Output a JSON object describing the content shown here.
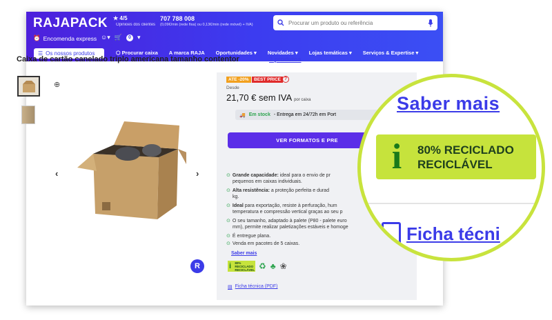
{
  "header": {
    "logo": "RAJAPACK",
    "rating": "4/5",
    "rating_sub": "Opiniões dos clientes",
    "phone": "707 788 008",
    "phone_sub": "(0,09€/min (rede fixa) ou 0,13€/min (rede móvel) + IVA)",
    "search_placeholder": "Procurar um produto ou referência",
    "express": "Encomenda express",
    "cart_count": "0"
  },
  "nav": {
    "products_button": "Os nossos produtos",
    "items": [
      "Procurar caixa",
      "A marca RAJA",
      "Oportunidades",
      "Novidades",
      "Lojas temáticas",
      "Serviços & Expertise"
    ]
  },
  "product": {
    "title": "Caixa de cartão canelado triplo americana tamanho contentor",
    "products_link": "3 produtos",
    "tag1": "ATE -20%",
    "tag2": "BEST PRICE",
    "desde": "Desde",
    "price": "21,70 € sem IVA",
    "price_unit": "por caixa",
    "stock_label": "Em stock",
    "stock_text": "- Entrega em 24/72h em Port",
    "cta": "VER FORMATOS E PRE",
    "features": [
      {
        "bold": "Grande capacidade:",
        "text": " ideal para o envio de pr",
        "line2": "pequenos em caixas individuais."
      },
      {
        "bold": "Alta resistência:",
        "text": " a proteção perfeita e durad",
        "line2": "kg."
      },
      {
        "bold": "Ideal",
        "text": " para exportação, resiste à perfuração, hum",
        "line2": "temperatura e compressão vertical graças ao seu p"
      },
      {
        "bold": "",
        "text": "O seu tamanho, adaptado à palete (P80 - palete euro",
        "line2": "mm), permite realizar paletizações estáveis e homoge"
      },
      {
        "bold": "",
        "text": "É entregue plana.",
        "line2": ""
      },
      {
        "bold": "",
        "text": "Venda em pacotes de 5 caixas.",
        "line2": ""
      }
    ],
    "saber_mais": "Saber mais",
    "eco_line1": "80% RECICLADO",
    "eco_line2": "RECICLÁVEL",
    "ficha": "Ficha técnica (PDF)"
  },
  "zoom": {
    "saber_mais": "Saber mais",
    "eco_line1": "80% RECICLADO",
    "eco_line2": "RECICLÁVEL",
    "ficha": "Ficha técni"
  },
  "colors": {
    "brand": "#3b3be8",
    "accent_green": "#c8e33d",
    "stock_green": "#2ea44f",
    "best_price": "#e02b2b",
    "promo": "#f2a01d"
  }
}
